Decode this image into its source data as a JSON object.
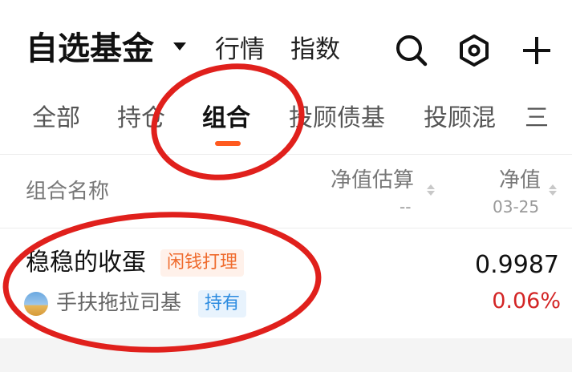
{
  "header": {
    "title": "自选基金",
    "nav_items": [
      "行情",
      "指数"
    ]
  },
  "tabs": [
    "全部",
    "持仓",
    "组合",
    "投顾债基",
    "投顾混",
    "三"
  ],
  "active_tab": "组合",
  "columns": {
    "name": "组合名称",
    "estimate": "净值估算",
    "estimate_sub": "--",
    "nav": "净值",
    "nav_date": "03-25"
  },
  "rows": [
    {
      "name": "稳稳的收蛋",
      "tag": "闲钱打理",
      "owner": "手扶拖拉司基",
      "owner_tag": "持有",
      "nav": "0.9987",
      "change": "0.06%"
    }
  ],
  "colors": {
    "accent": "#ff5a1f",
    "negative_red": "#d32525",
    "tag_orange": "#ef6b2d",
    "tag_blue": "#2b8be0",
    "annotation_red": "#e0201c"
  },
  "icons": [
    "caret-down-icon",
    "search-icon",
    "settings-hex-icon",
    "plus-icon",
    "sort-icon"
  ]
}
